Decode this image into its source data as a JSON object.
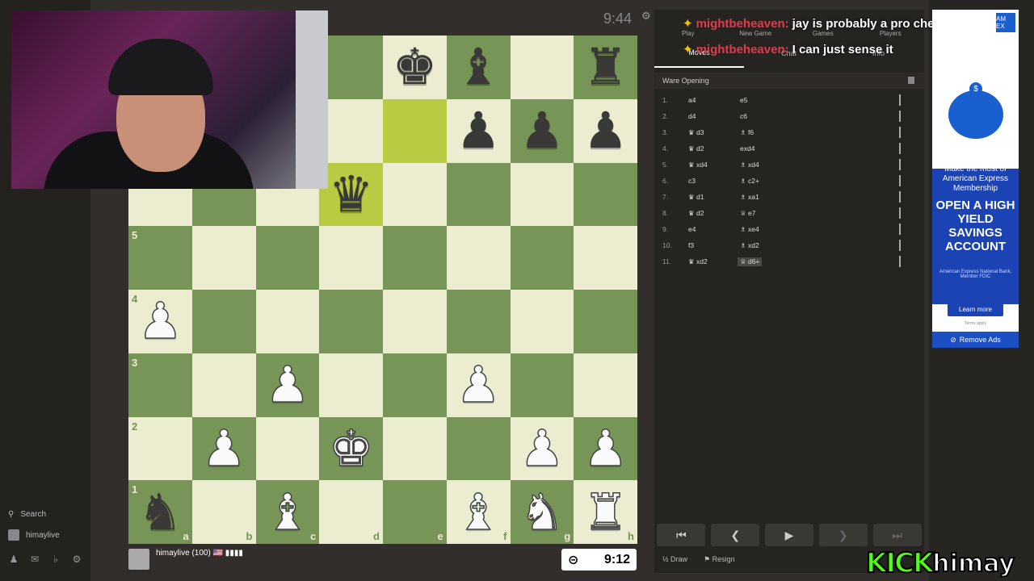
{
  "sidebar": {
    "search_label": "Search",
    "username": "himaylive"
  },
  "top_clock": "9:44",
  "board": {
    "ranks": [
      "8",
      "7",
      "6",
      "5",
      "4",
      "3",
      "2",
      "1"
    ],
    "files": [
      "a",
      "b",
      "c",
      "d",
      "e",
      "f",
      "g",
      "h"
    ],
    "squares": [
      [
        "",
        "",
        "",
        "",
        "bk",
        "bb",
        "",
        "br"
      ],
      [
        "",
        "",
        "bp",
        "",
        "",
        "bp",
        "bp",
        "bp"
      ],
      [
        "",
        "",
        "",
        "bq",
        "",
        "",
        "",
        ""
      ],
      [
        "",
        "",
        "",
        "",
        "",
        "",
        "",
        ""
      ],
      [
        "wp",
        "",
        "",
        "",
        "",
        "",
        "",
        ""
      ],
      [
        "",
        "",
        "wp",
        "",
        "",
        "wp",
        "",
        ""
      ],
      [
        "",
        "wp",
        "",
        "wk",
        "",
        "",
        "wp",
        "wp"
      ],
      [
        "bn",
        "",
        "wb",
        "",
        "",
        "wb",
        "wn",
        "wr"
      ]
    ],
    "highlighted": [
      "e7",
      "d6"
    ]
  },
  "bottom_player": {
    "name": "himaylive (100) 🇺🇸 ▮▮▮▮",
    "clock": "9:12"
  },
  "panel": {
    "top_tabs": [
      "Play",
      "New Game",
      "Games",
      "Players"
    ],
    "sub_tabs": [
      "Moves",
      "Chat",
      "Info"
    ],
    "opening": "Ware Opening",
    "moves": [
      {
        "num": "1.",
        "white": "a4",
        "black": "e5"
      },
      {
        "num": "2.",
        "white": "d4",
        "black": "c6"
      },
      {
        "num": "3.",
        "white": "♛ d3",
        "black": "♗ f6"
      },
      {
        "num": "4.",
        "white": "♛ d2",
        "black": "exd4"
      },
      {
        "num": "5.",
        "white": "♛ xd4",
        "black": "♗ xd4"
      },
      {
        "num": "6.",
        "white": "c3",
        "black": "♗ c2+"
      },
      {
        "num": "7.",
        "white": "♛ d1",
        "black": "♗ xa1"
      },
      {
        "num": "8.",
        "white": "♛ d2",
        "black": "♕ e7"
      },
      {
        "num": "9.",
        "white": "e4",
        "black": "♗ xe4"
      },
      {
        "num": "10.",
        "white": "f3",
        "black": "♗ xd2"
      },
      {
        "num": "11.",
        "white": "♛ xd2",
        "black": "♕ d6+"
      }
    ],
    "draw_label": "Draw",
    "resign_label": "Resign"
  },
  "chat_overlay": [
    {
      "user": "mightbeheaven:",
      "msg": "jay is probably a pro chess playe"
    },
    {
      "user": "mightbeheaven:",
      "msg": "I can just sense it"
    }
  ],
  "ad": {
    "make_the_most": "Make the most of American Express Membership",
    "headline": "OPEN A HIGH YIELD SAVINGS ACCOUNT",
    "small_print": "American Express National Bank, Member FDIC",
    "learn_more": "Learn more",
    "terms": "Terms apply",
    "logo": "AM EX",
    "remove_ads": "Remove Ads"
  },
  "kick": {
    "logo": "KICK",
    "channel": "himay"
  }
}
